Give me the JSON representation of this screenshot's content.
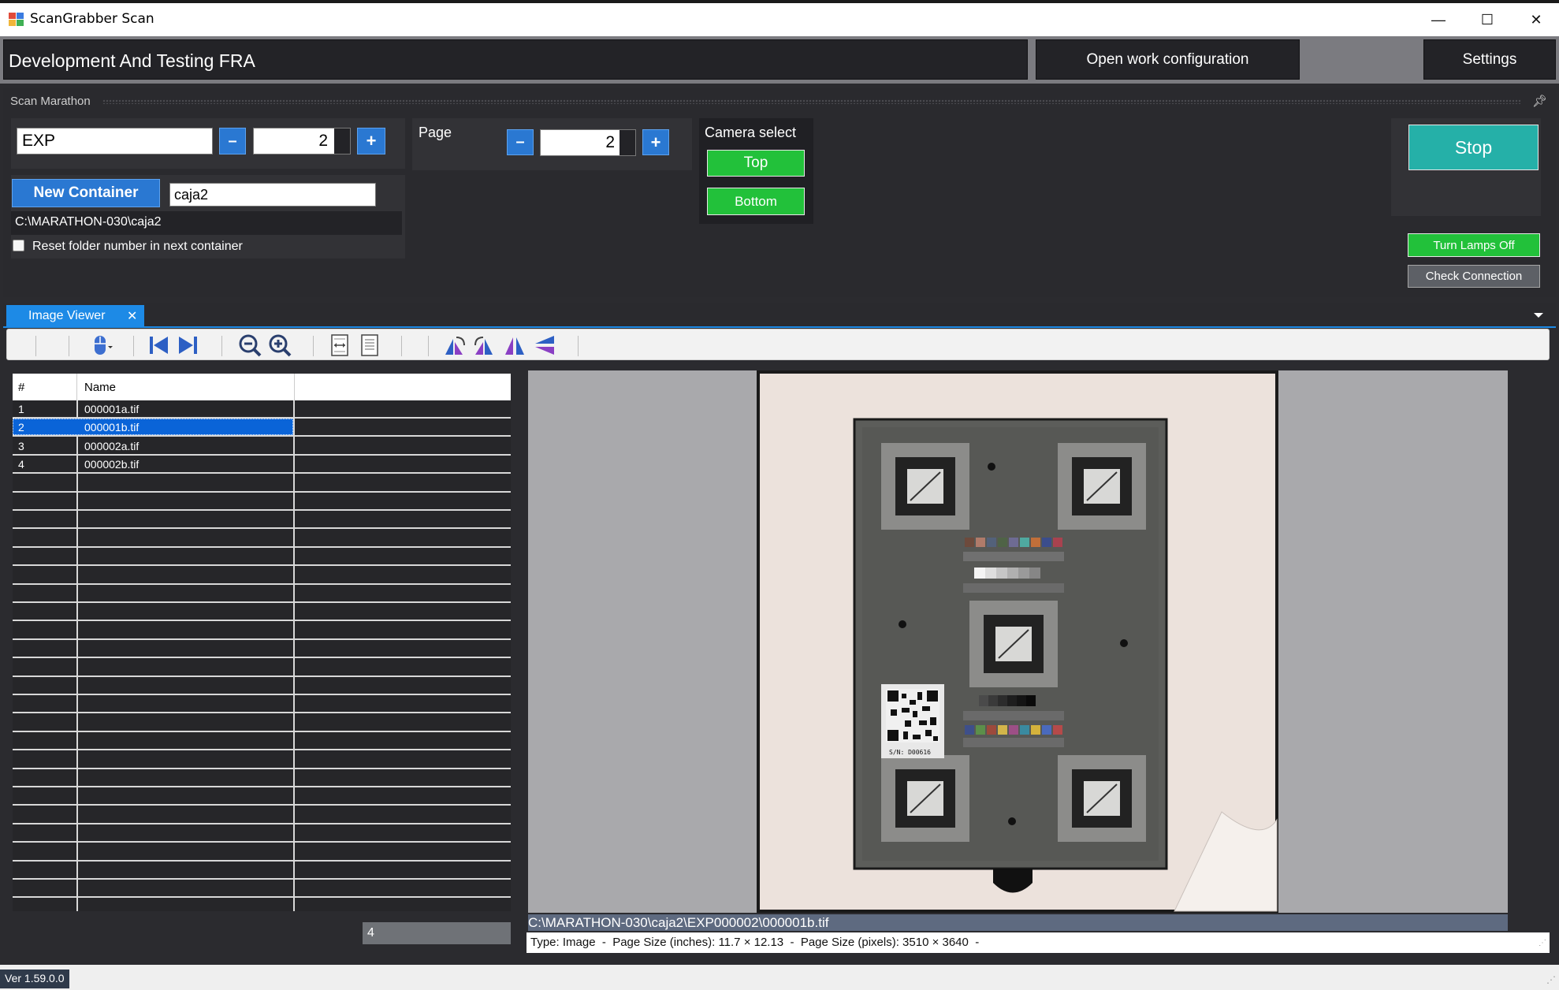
{
  "window": {
    "title": "ScanGrabber Scan",
    "minimize": "—",
    "maximize": "☐",
    "close": "✕"
  },
  "header": {
    "project_title": "Development And Testing FRA",
    "open_config_label": "Open work configuration",
    "settings_label": "Settings"
  },
  "marathon": {
    "caption": "Scan Marathon",
    "prefix_value": "EXP",
    "folder_number": "2",
    "minus": "–",
    "plus": "+",
    "new_container_label": "New Container",
    "container_name": "caja2",
    "container_path": "C:\\MARATHON-030\\caja2",
    "reset_label": "Reset folder number in next container",
    "reset_checked": false,
    "page_label": "Page",
    "page_number": "2",
    "camera_select_label": "Camera select",
    "camera_top": "Top",
    "camera_bottom": "Bottom",
    "stop_label": "Stop",
    "lamps_label": "Turn Lamps Off",
    "check_connection_label": "Check Connection"
  },
  "tabs": [
    {
      "label": "Image Viewer",
      "close": "✕"
    }
  ],
  "list": {
    "columns": [
      "#",
      "Name"
    ],
    "rows": [
      {
        "num": "1",
        "name": "000001a.tif",
        "selected": false
      },
      {
        "num": "2",
        "name": "000001b.tif",
        "selected": true
      },
      {
        "num": "3",
        "name": "000002a.tif",
        "selected": false
      },
      {
        "num": "4",
        "name": "000002b.tif",
        "selected": false
      }
    ],
    "count": "4"
  },
  "viewer": {
    "file_path": "C:\\MARATHON-030\\caja2\\EXP000002\\000001b.tif",
    "info": "Type: Image  -  Page Size (inches): 11.7 × 12.13  -  Page Size (pixels): 3510 × 3640  -",
    "target_serial": "S/N: D00616"
  },
  "status": {
    "version": "Ver 1.59.0.0"
  },
  "colors": {
    "accent_blue": "#1d8ae6",
    "stop_teal": "#25b0a8",
    "camera_green": "#22c13a",
    "selection": "#0a64d8"
  }
}
